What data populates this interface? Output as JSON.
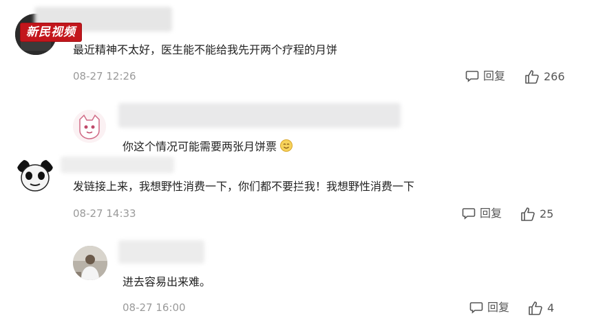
{
  "watermark": {
    "text": "新民视频"
  },
  "comments": [
    {
      "text": "最近精神不太好，医生能不能给我先开两个疗程的月饼",
      "time": "08-27 12:26",
      "reply_label": "回复",
      "likes": "266"
    },
    {
      "text": "你这个情况可能需要两张月饼票",
      "emoji": "smile-emoji"
    },
    {
      "text": "发链接上来，我想野性消费一下，你们都不要拦我！我想野性消费一下",
      "time": "08-27 14:33",
      "reply_label": "回复",
      "likes": "25"
    },
    {
      "text": "进去容易出来难。",
      "time": "08-27 16:00",
      "reply_label": "回复",
      "likes": "4"
    }
  ],
  "icons": {
    "reply": "speech-bubble-icon",
    "like": "thumbs-up-icon"
  },
  "colors": {
    "watermark_bg": "#c3161c",
    "timestamp": "#9a9a9a",
    "text": "#222222"
  }
}
